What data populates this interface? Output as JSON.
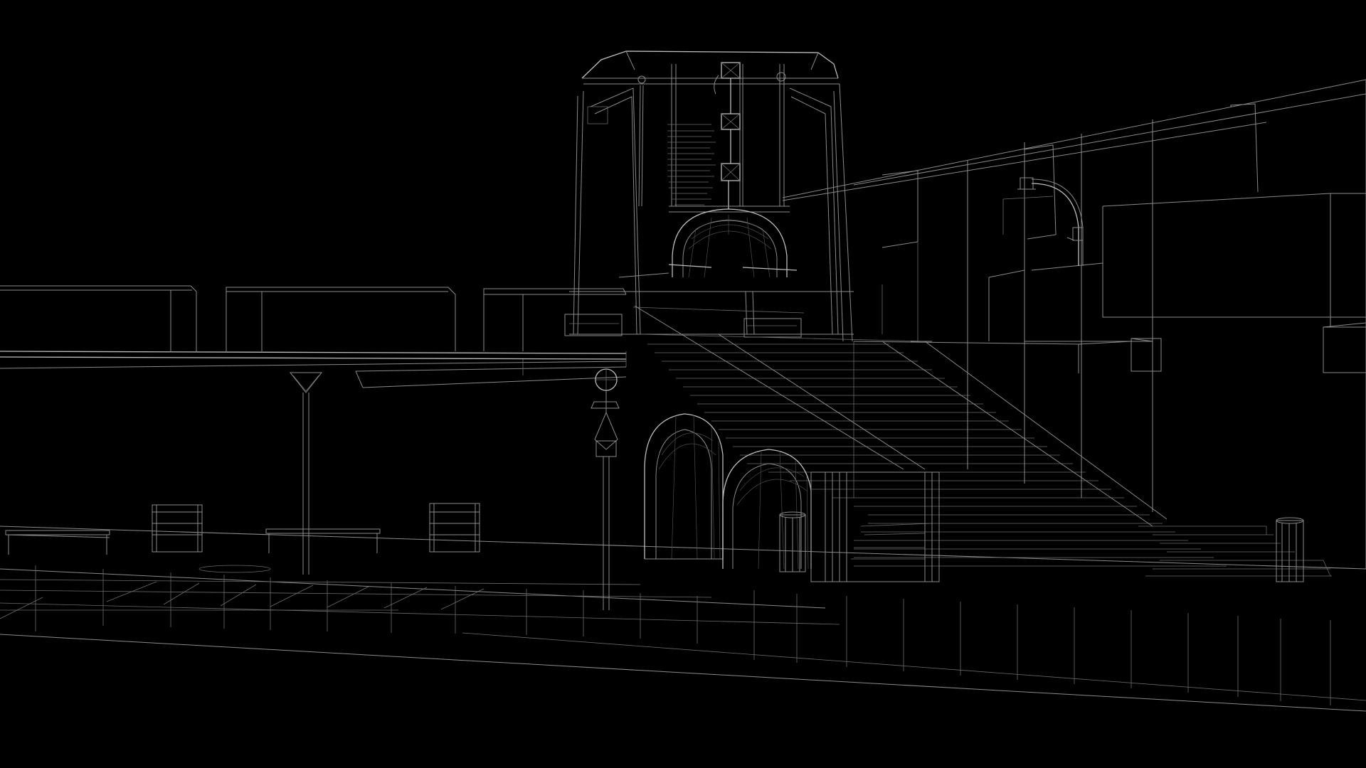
{
  "scene": {
    "kind": "wireframe-render",
    "background_color": "#000000",
    "line_color": "#9a9a9a",
    "highlight_line_color": "#d0d0d0"
  },
  "icons": {
    "viewport": "wireframe-viewport"
  }
}
